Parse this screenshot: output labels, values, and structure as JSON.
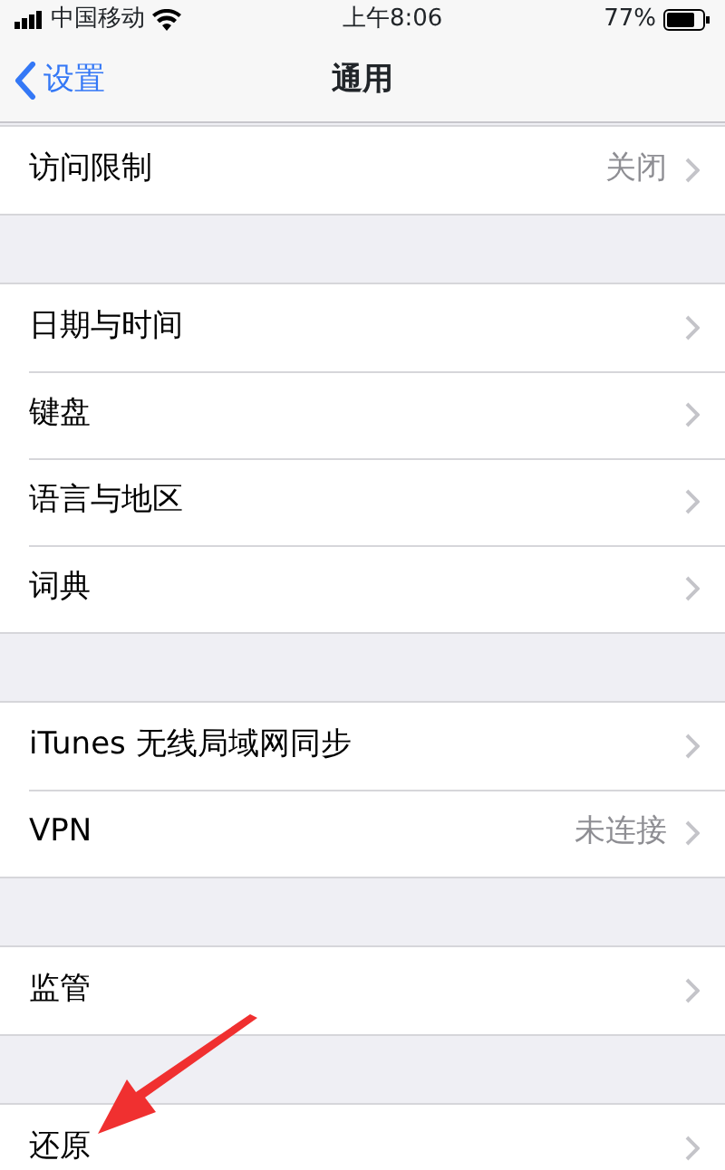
{
  "status_bar": {
    "carrier": "中国移动",
    "time": "上午8:06",
    "battery": "77%"
  },
  "nav": {
    "back": "设置",
    "title": "通用"
  },
  "groups": [
    {
      "rows": [
        {
          "label": "访问限制",
          "value": "关闭"
        }
      ]
    },
    {
      "rows": [
        {
          "label": "日期与时间"
        },
        {
          "label": "键盘"
        },
        {
          "label": "语言与地区"
        },
        {
          "label": "词典"
        }
      ]
    },
    {
      "rows": [
        {
          "label": "iTunes 无线局域网同步"
        },
        {
          "label": "VPN",
          "value": "未连接"
        }
      ]
    },
    {
      "rows": [
        {
          "label": "监管"
        }
      ]
    },
    {
      "rows": [
        {
          "label": "还原"
        }
      ]
    }
  ]
}
